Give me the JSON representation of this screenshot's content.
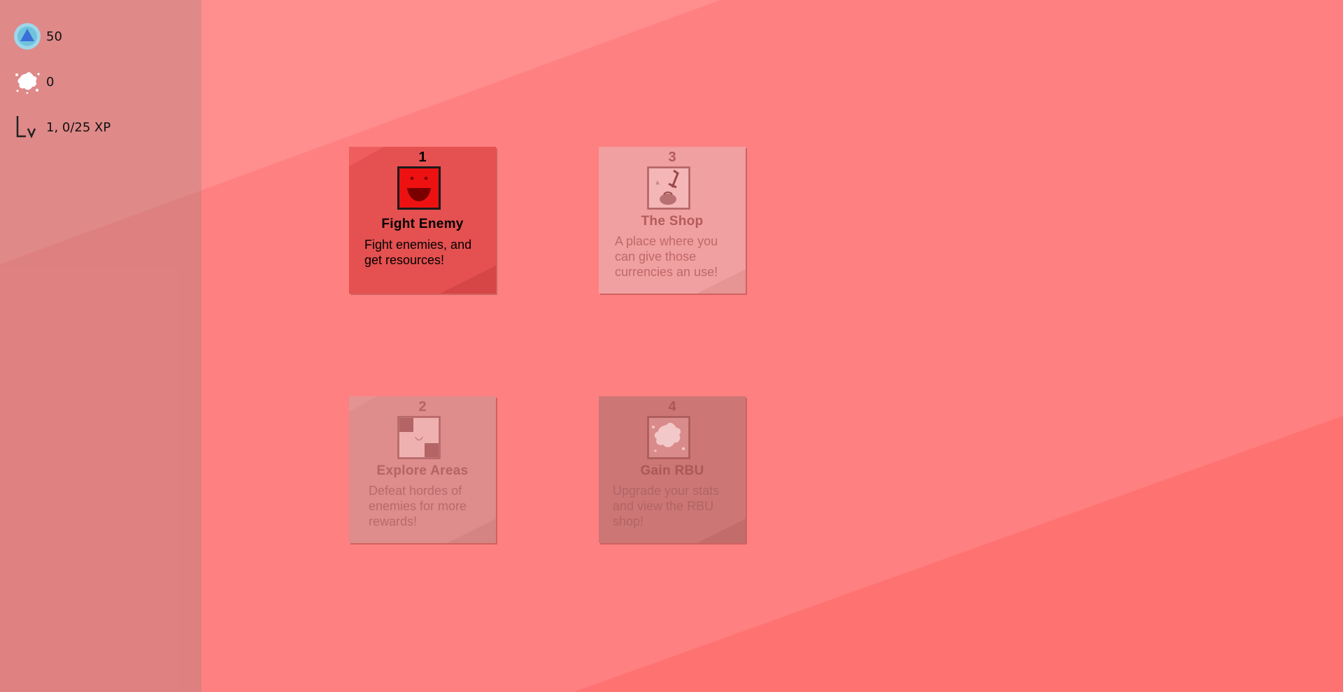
{
  "colors": {
    "background": "#ff8080",
    "sidebar": "#d48888",
    "fight_card": "#e55050",
    "shop_card": "#f0a0a0",
    "explore_card": "#de8c8c",
    "rbu_card": "#cd7676"
  },
  "stats": {
    "points": {
      "icon": "blue-triangle-orb-icon",
      "value": "50"
    },
    "rbu": {
      "icon": "white-splat-icon",
      "value": "0"
    },
    "level": {
      "icon": "level-lv-icon",
      "value": "1, 0/25 XP"
    }
  },
  "cards": {
    "fight": {
      "number": "1",
      "icon": "smiley-face-icon",
      "title": "Fight Enemy",
      "description": "Fight enemies, and get resources!",
      "state": "active"
    },
    "shop": {
      "number": "3",
      "icon": "shop-sword-bag-icon",
      "title": "The Shop",
      "description": "A place where you can give those currencies an use!",
      "state": "locked"
    },
    "explore": {
      "number": "2",
      "icon": "checker-map-icon",
      "title": "Explore Areas",
      "description": "Defeat hordes of enemies for more rewards!",
      "state": "locked"
    },
    "rbu": {
      "number": "4",
      "icon": "rbu-splat-icon",
      "title": "Gain RBU",
      "description": "Upgrade your stats and view the RBU shop!",
      "state": "locked"
    }
  }
}
